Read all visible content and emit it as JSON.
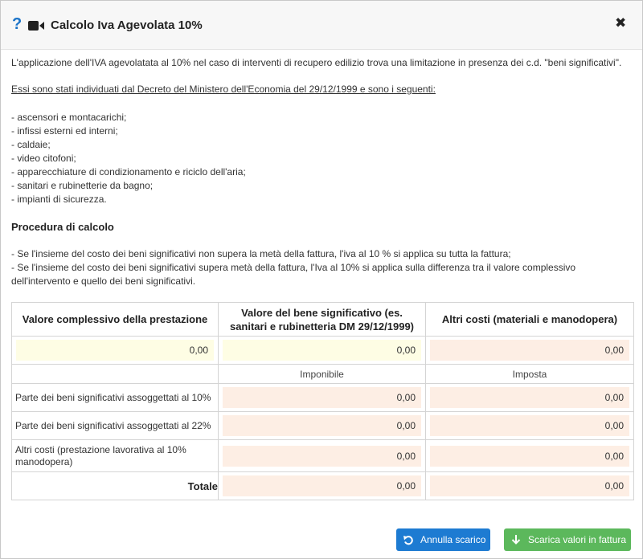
{
  "header": {
    "title": "Calcolo Iva Agevolata 10%",
    "help_glyph": "?",
    "close_glyph": "✖"
  },
  "intro": {
    "p1": "L'applicazione dell'IVA agevolatata al 10% nel caso di interventi di recupero edilizio trova una limitazione in presenza dei c.d. \"beni significativi\".",
    "p2": "Essi sono stati individuati dal Decreto del Ministero dell'Economia del 29/12/1999 e sono i seguenti:",
    "items": [
      "- ascensori e montacarichi;",
      "- infissi esterni ed interni;",
      "- caldaie;",
      "- video citofoni;",
      "- apparecchiature di condizionamento e riciclo dell'aria;",
      "- sanitari e rubinetterie da bagno;",
      "- impianti di sicurezza."
    ]
  },
  "procedura": {
    "title": "Procedura di calcolo",
    "lines": [
      "- Se l'insieme del costo dei beni significativi non supera la metà della fattura, l'iva al 10 % si applica su tutta la fattura;",
      "- Se l'insieme del costo dei beni significativi supera metà della fattura, l'Iva al 10% si applica sulla differenza tra il valore complessivo",
      "dell'intervento e quello dei beni significativi."
    ]
  },
  "table": {
    "col1_header": "Valore complessivo della prestazione",
    "col2_header": "Valore del bene significativo (es. sanitari e rubinetteria DM 29/12/1999)",
    "col3_header": "Altri costi (materiali e manodopera)",
    "input_row": [
      "0,00",
      "0,00",
      "0,00"
    ],
    "subheaders": [
      "Imponibile",
      "Imposta"
    ],
    "rows": [
      {
        "label": "Parte dei beni significativi assoggettati al 10%",
        "imponibile": "0,00",
        "imposta": "0,00"
      },
      {
        "label": "Parte dei beni significativi assoggettati al 22%",
        "imponibile": "0,00",
        "imposta": "0,00"
      },
      {
        "label": "Altri costi (prestazione lavorativa al 10% manodopera)",
        "imponibile": "0,00",
        "imposta": "0,00"
      }
    ],
    "total": {
      "label": "Totale",
      "imponibile": "0,00",
      "imposta": "0,00"
    }
  },
  "buttons": {
    "annulla": "Annulla scarico",
    "scarica": "Scarica valori in fattura"
  },
  "colors": {
    "accent_blue": "#1d7bd2",
    "success_green": "#5cb85c",
    "input_yellow": "#fefde4",
    "input_peach": "#fdeee4"
  },
  "icons": {
    "help": "help-icon",
    "video": "video-camera-icon",
    "close": "close-icon",
    "undo": "undo-icon",
    "download": "arrow-down-icon"
  }
}
